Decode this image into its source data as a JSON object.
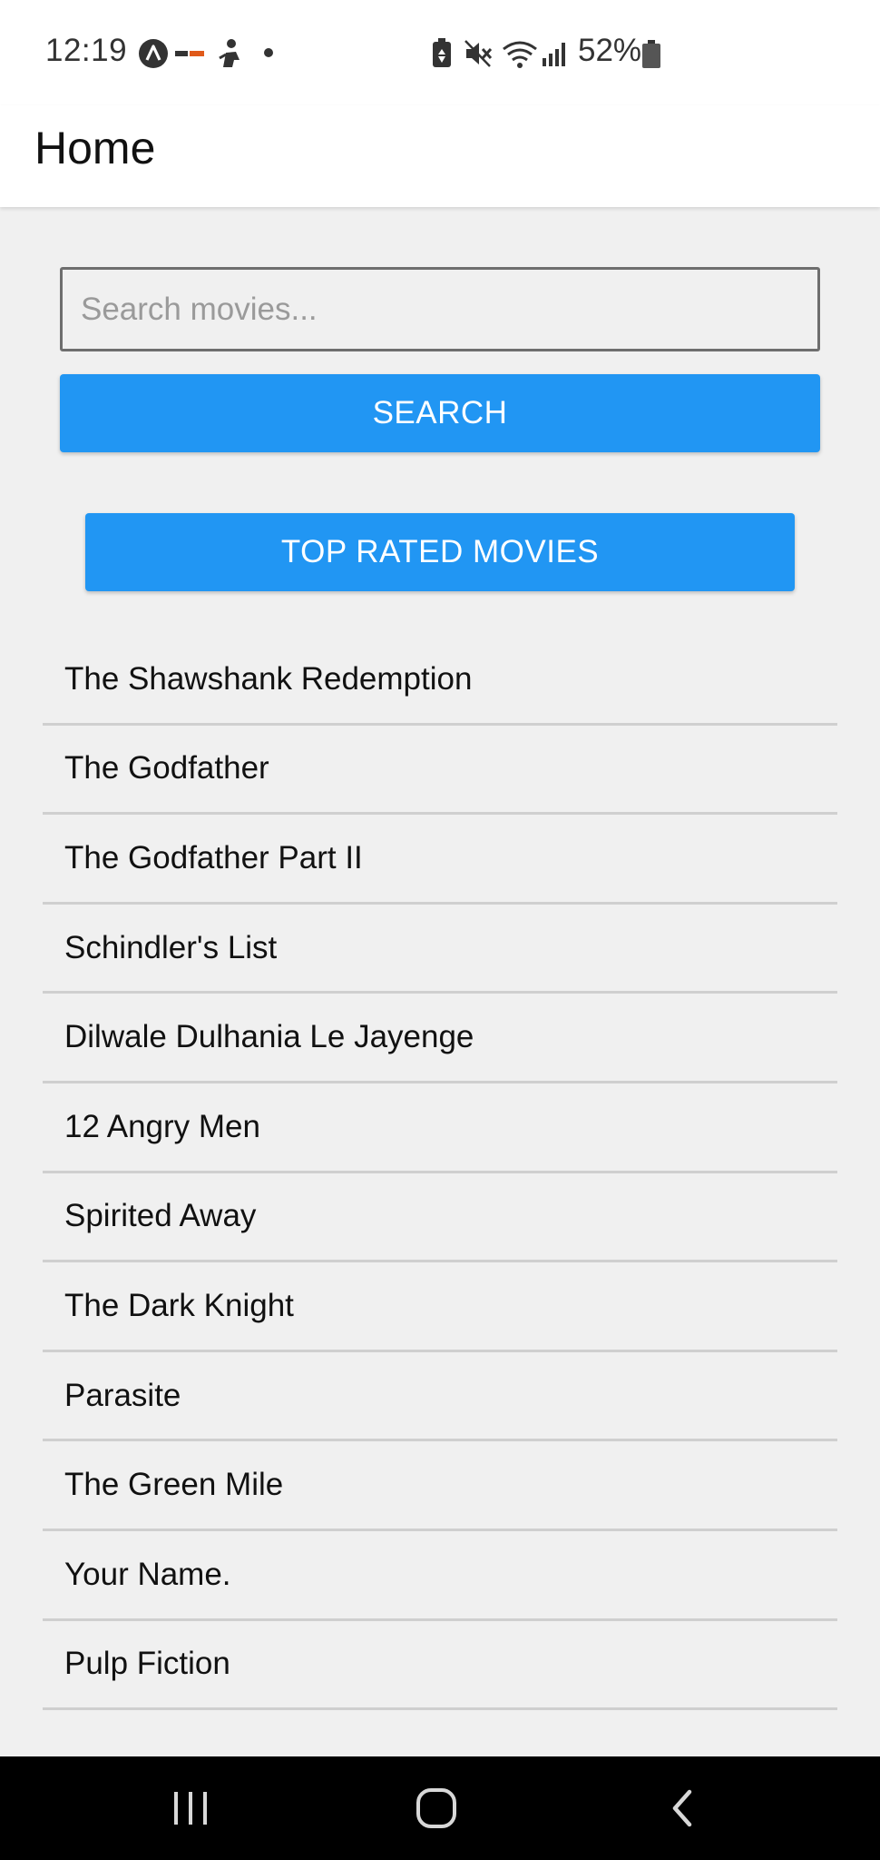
{
  "status_bar": {
    "time": "12:19",
    "battery": "52%",
    "icons": [
      "navigation-app-icon",
      "coindcx-icon",
      "person-icon",
      "dot-icon",
      "battery-saver-icon",
      "mute-icon",
      "wifi-icon",
      "signal-icon",
      "battery-icon"
    ]
  },
  "app_bar": {
    "title": "Home"
  },
  "search": {
    "placeholder": "Search movies...",
    "value": "",
    "button_label": "SEARCH"
  },
  "top_rated_button_label": "TOP RATED MOVIES",
  "movies": [
    "The Shawshank Redemption",
    "The Godfather",
    "The Godfather Part II",
    "Schindler's List",
    "Dilwale Dulhania Le Jayenge",
    "12 Angry Men",
    "Spirited Away",
    "The Dark Knight",
    "Parasite",
    "The Green Mile",
    "Your Name.",
    "Pulp Fiction"
  ],
  "nav_bar": {
    "icons": [
      "recent-apps-icon",
      "home-icon",
      "back-icon"
    ]
  },
  "colors": {
    "accent": "#2196f3",
    "background": "#f0f0f0",
    "app_bar": "#ffffff",
    "nav_bar": "#000000"
  }
}
